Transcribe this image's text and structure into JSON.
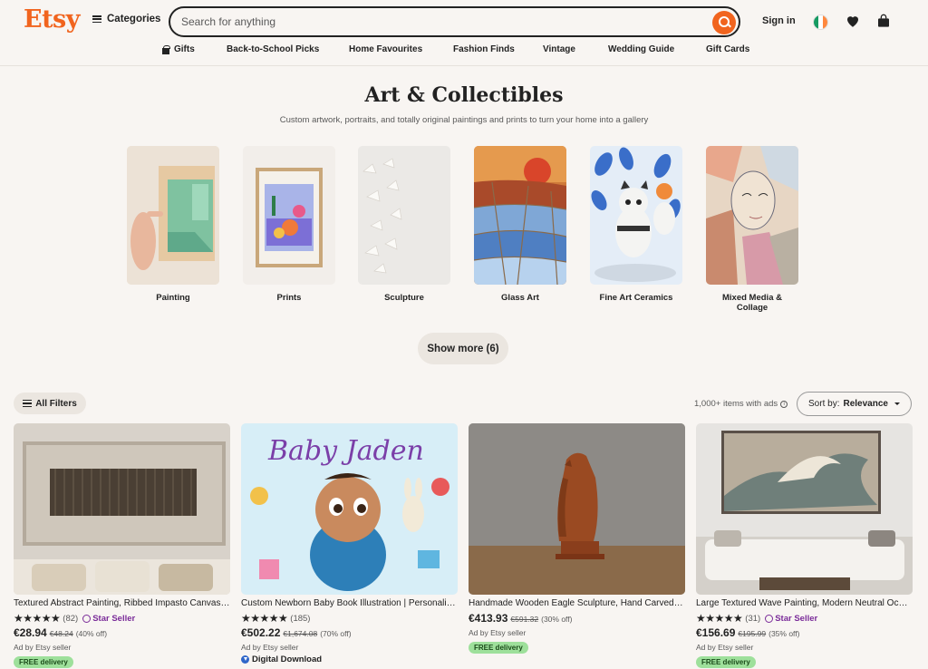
{
  "header": {
    "logo": "Etsy",
    "categories_label": "Categories",
    "search_placeholder": "Search for anything",
    "signin_label": "Sign in"
  },
  "nav": [
    {
      "label": "Gifts",
      "icon": "gift-icon"
    },
    {
      "label": "Back-to-School Picks"
    },
    {
      "label": "Home Favourites"
    },
    {
      "label": "Fashion Finds"
    },
    {
      "label": "Vintage"
    },
    {
      "label": "Wedding Guide"
    },
    {
      "label": "Gift Cards"
    }
  ],
  "page": {
    "title": "Art & Collectibles",
    "subtitle": "Custom artwork, portraits, and totally original paintings and prints to turn your home into a gallery"
  },
  "categories": [
    {
      "label": "Painting"
    },
    {
      "label": "Prints"
    },
    {
      "label": "Sculpture"
    },
    {
      "label": "Glass Art"
    },
    {
      "label": "Fine Art Ceramics"
    },
    {
      "label": "Mixed Media & Collage"
    }
  ],
  "show_more_label": "Show more (6)",
  "filters": {
    "all_filters_label": "All Filters",
    "results_text": "1,000+ items with ads",
    "sort_prefix": "Sort by:",
    "sort_value": "Relevance"
  },
  "listings": [
    {
      "title": "Textured Abstract Painting, Ribbed Impasto Canvas Art",
      "stars": "★★★★★",
      "reviews": "(82)",
      "star_seller": "Star Seller",
      "price": "€28.94",
      "original_price": "€48.24",
      "discount": "(40% off)",
      "ad_text": "Ad by Etsy seller",
      "badge": "FREE delivery"
    },
    {
      "title": "Custom Newborn Baby Book Illustration | Personalized Portrait",
      "stars": "★★★★★",
      "reviews": "(185)",
      "price": "€502.22",
      "original_price": "€1,674.08",
      "discount": "(70% off)",
      "ad_text": "Ad by Etsy seller",
      "badge": "Digital Download"
    },
    {
      "title": "Handmade Wooden Eagle Sculpture, Hand Carved Bird Figurine",
      "price": "€413.93",
      "original_price": "€591.32",
      "discount": "(30% off)",
      "ad_text": "Ad by Etsy seller",
      "badge": "FREE delivery"
    },
    {
      "title": "Large Textured Wave Painting, Modern Neutral Ocean Art",
      "stars": "★★★★★",
      "reviews": "(31)",
      "star_seller": "Star Seller",
      "price": "€156.69",
      "original_price": "€195.99",
      "discount": "(35% off)",
      "ad_text": "Ad by Etsy seller",
      "badge": "FREE delivery"
    }
  ],
  "colors": {
    "brand": "#f1641e",
    "star_seller": "#7a2b99",
    "free_delivery_bg": "#9ee09b"
  }
}
